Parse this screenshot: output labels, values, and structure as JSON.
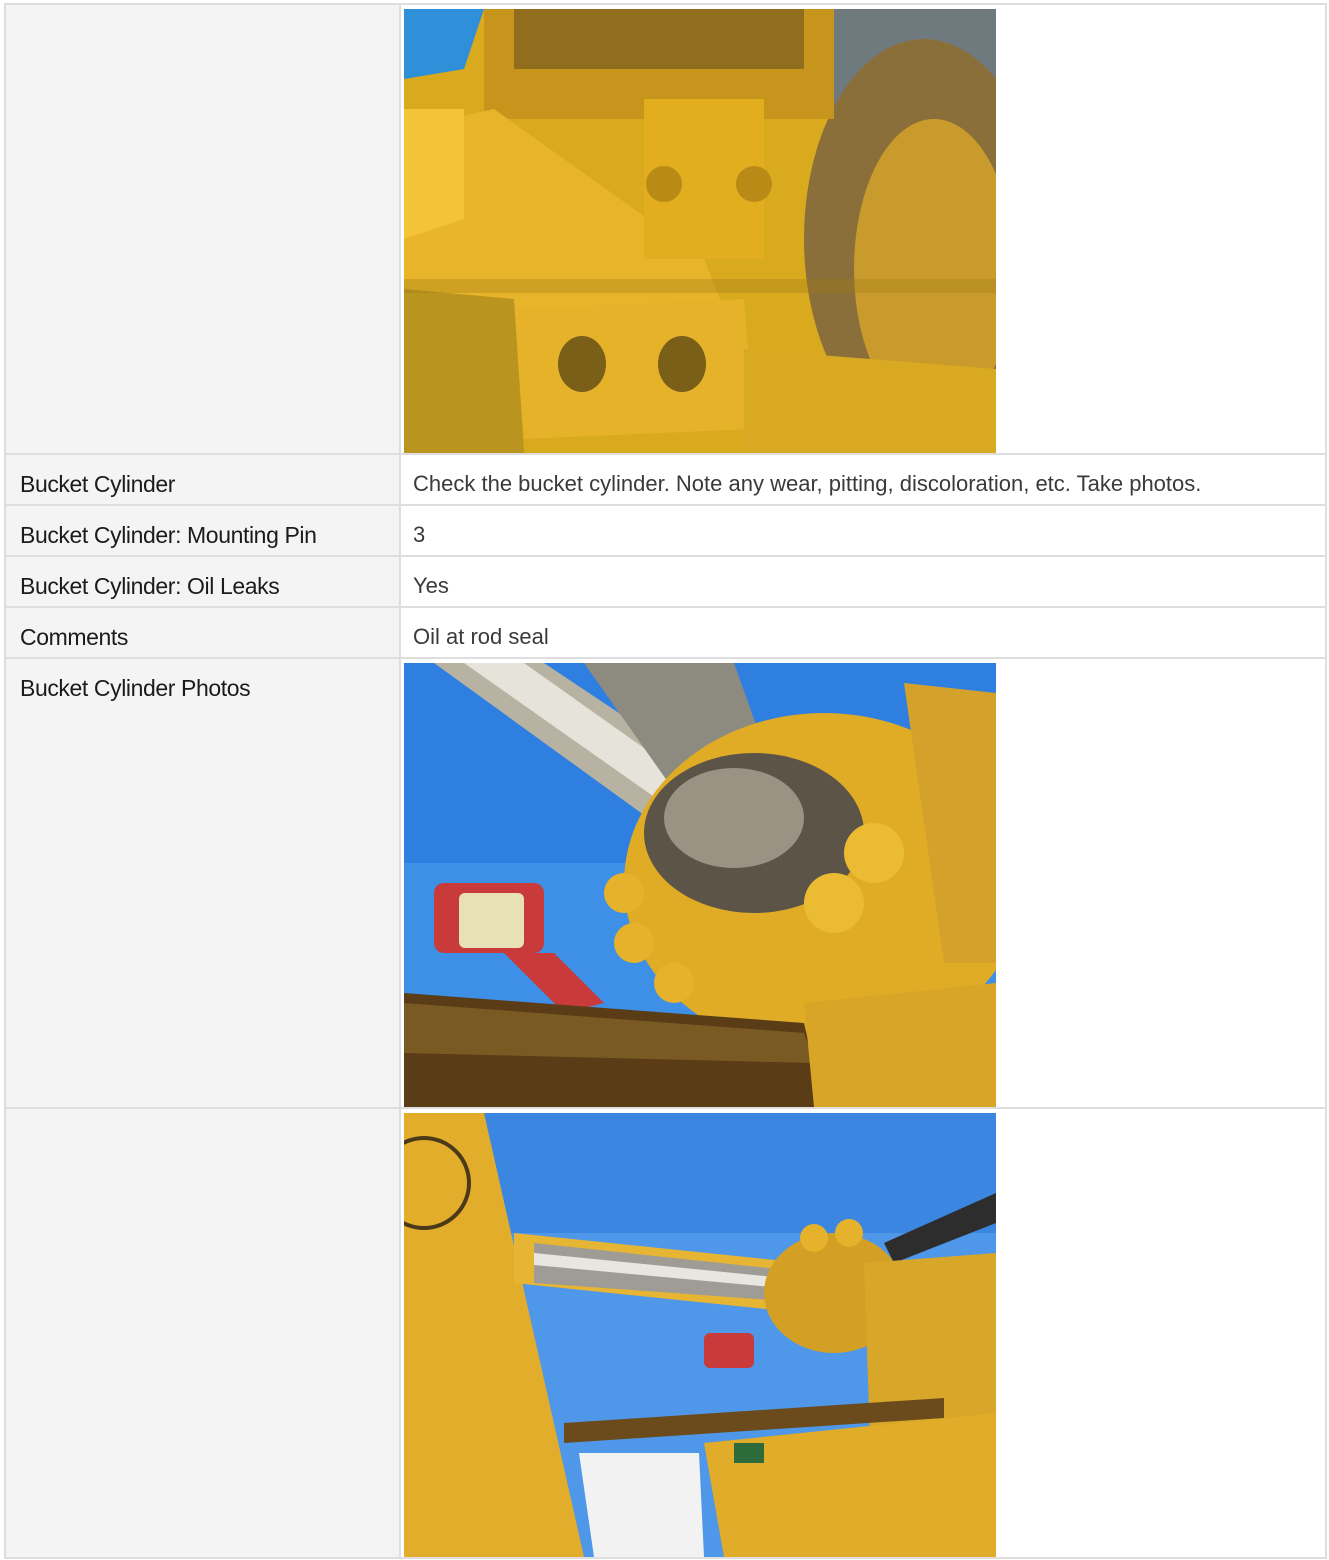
{
  "rows": [
    {
      "label": "",
      "type": "photo",
      "photo": "photo-wheel-loader-hinge"
    },
    {
      "label": "Bucket Cylinder",
      "type": "text",
      "value": "Check the bucket cylinder. Note any wear, pitting, discoloration, etc. Take photos."
    },
    {
      "label": "Bucket Cylinder: Mounting Pin",
      "type": "text",
      "value": "3"
    },
    {
      "label": "Bucket Cylinder: Oil Leaks",
      "type": "text",
      "value": "Yes"
    },
    {
      "label": "Comments",
      "type": "text",
      "value": "Oil at rod seal"
    },
    {
      "label": "Bucket Cylinder Photos",
      "type": "photo",
      "photo": "photo-bucket-cylinder-rod-seal"
    },
    {
      "label": "",
      "type": "photo",
      "photo": "photo-bucket-cylinder-side"
    }
  ],
  "colors": {
    "label_bg": "#f4f4f4",
    "border": "#dedede",
    "machine_yellow": "#e7b52a",
    "sky_blue": "#3f8ee6"
  }
}
